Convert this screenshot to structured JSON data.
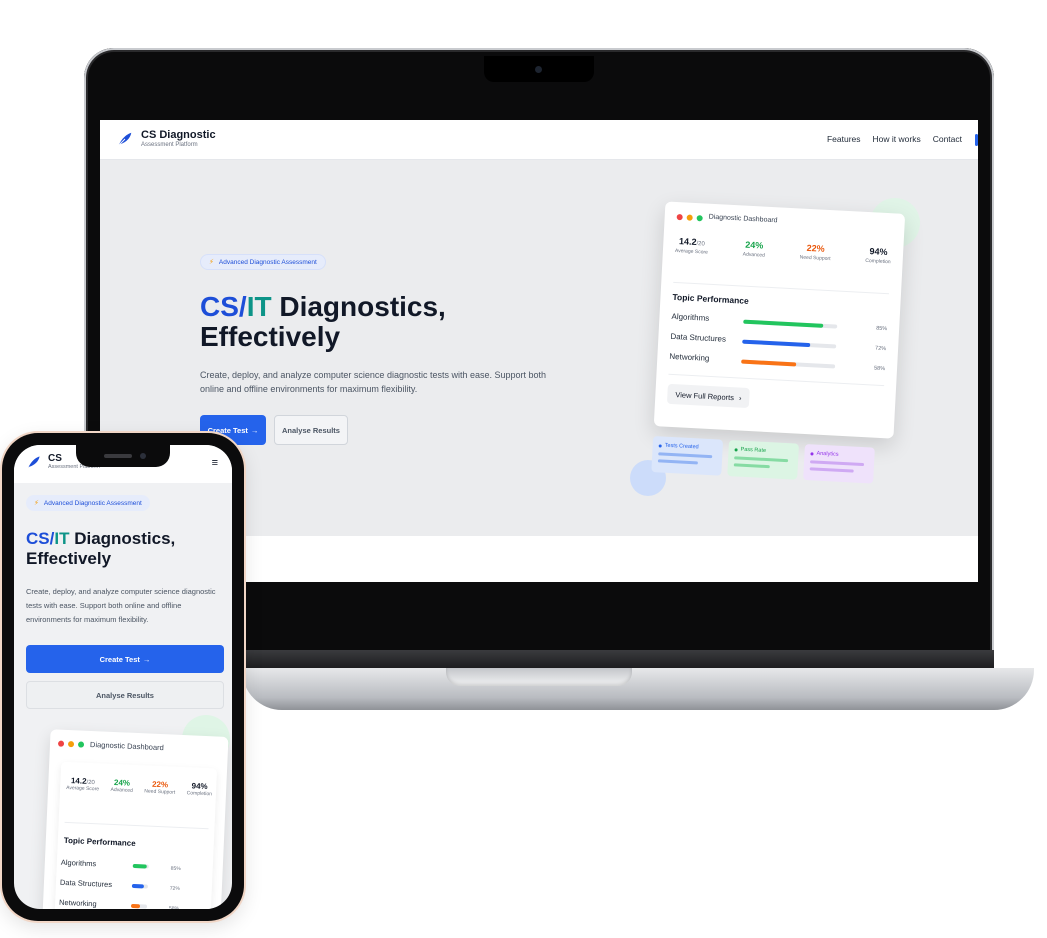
{
  "app": {
    "brand_title": "CS Diagnostic",
    "brand_subtitle": "Assessment Platform",
    "nav_links": [
      "Features",
      "How it works",
      "Contact"
    ]
  },
  "hero": {
    "badge": "Advanced Diagnostic Assessment",
    "title_cs": "CS",
    "title_slash": "/",
    "title_it": "IT",
    "title_rest_1": " Diagnostics,",
    "title_rest_2": "Effectively",
    "description": "Create, deploy, and analyze computer science diagnostic tests with ease. Support both online and offline environments for maximum flexibility.",
    "primary_button": "Create Test",
    "secondary_button": "Analyse Results",
    "arrow": "→"
  },
  "dashboard": {
    "title": "Diagnostic Dashboard",
    "stats": [
      {
        "value": "14.2",
        "suffix": "/20",
        "label": "Average Score",
        "color": "#111827"
      },
      {
        "value": "24%",
        "suffix": "",
        "label": "Advanced",
        "color": "#16a34a"
      },
      {
        "value": "22%",
        "suffix": "",
        "label": "Need Support",
        "color": "#ea580c"
      },
      {
        "value": "94%",
        "suffix": "",
        "label": "Completion",
        "color": "#111827"
      }
    ],
    "topic_title": "Topic Performance",
    "topics": [
      {
        "name": "Algorithms",
        "percent": 85,
        "label": "85%",
        "color": "#22c55e"
      },
      {
        "name": "Data Structures",
        "percent": 72,
        "label": "72%",
        "color": "#2563eb"
      },
      {
        "name": "Networking",
        "percent": 58,
        "label": "58%",
        "color": "#f97316"
      }
    ],
    "view_button": "View Full Reports",
    "view_chevron": "›",
    "mini_cards": [
      {
        "label": "Tests Created",
        "color": "#2563eb",
        "bg": "#dbe6fb",
        "line": "#93b4f4"
      },
      {
        "label": "Pass Rate",
        "color": "#16a34a",
        "bg": "#dcf5e4",
        "line": "#86dba3"
      },
      {
        "label": "Analytics",
        "color": "#9333ea",
        "bg": "#efe2fb",
        "line": "#cfa9f3"
      }
    ]
  },
  "phone": {
    "brand_title": "CS",
    "brand_subtitle": "Assessment Platform",
    "menu_icon": "≡"
  },
  "colors": {
    "accent": "#2563eb",
    "teal": "#0d9488"
  }
}
